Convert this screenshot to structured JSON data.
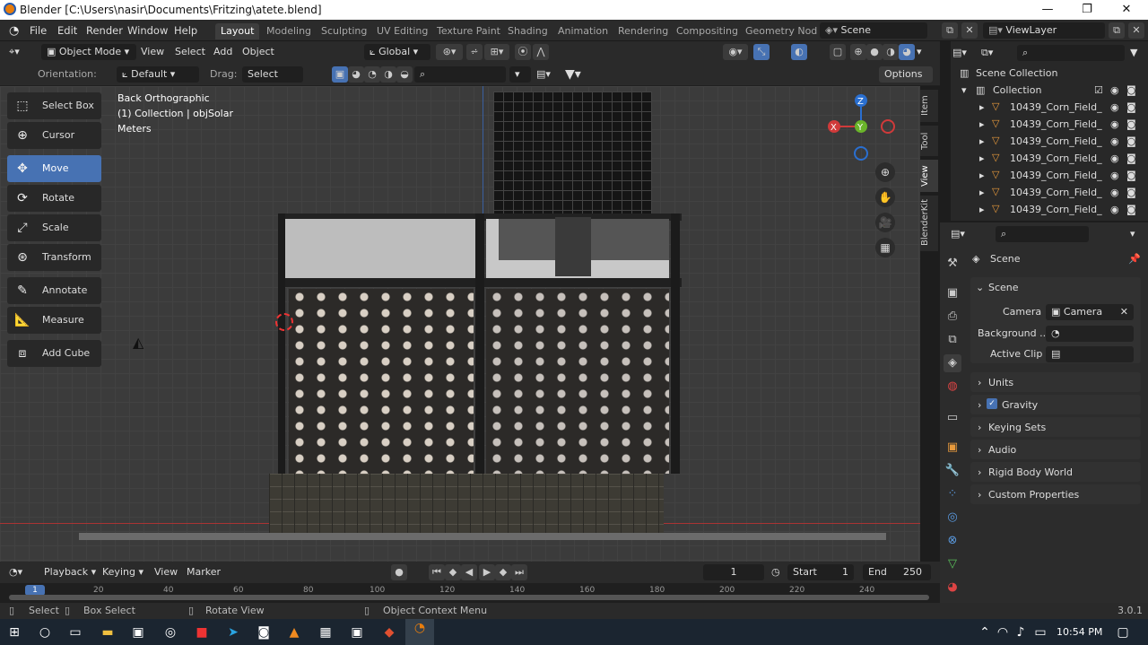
{
  "window": {
    "title": "Blender [C:\\Users\\nasir\\Documents\\Fritzing\\atete.blend]",
    "minimize": "—",
    "maximize": "❐",
    "close": "✕"
  },
  "menu": {
    "items": [
      "File",
      "Edit",
      "Render",
      "Window",
      "Help"
    ]
  },
  "workspaces": [
    "Layout",
    "Modeling",
    "Sculpting",
    "UV Editing",
    "Texture Paint",
    "Shading",
    "Animation",
    "Rendering",
    "Compositing",
    "Geometry Nod"
  ],
  "scene_name": "Scene",
  "view_layer": "ViewLayer",
  "viewport_header": {
    "mode": "Object Mode",
    "menus": [
      "View",
      "Select",
      "Add",
      "Object"
    ],
    "transform": "Global",
    "options": "Options"
  },
  "tool_settings": {
    "orientation_label": "Orientation:",
    "orientation_value": "Default",
    "drag_label": "Drag:",
    "drag_value": "Select Box"
  },
  "toolbar": [
    "Select Box",
    "Cursor",
    "Move",
    "Rotate",
    "Scale",
    "Transform",
    "Annotate",
    "Measure",
    "Add Cube"
  ],
  "viewport_info": {
    "view": "Back Orthographic",
    "collection": "(1) Collection | objSolar",
    "units": "Meters"
  },
  "gizmo": {
    "z": "Z",
    "y": "Y",
    "x": "X"
  },
  "sidebar_tabs": [
    "Item",
    "Tool",
    "View",
    "BlenderKit"
  ],
  "outliner": {
    "root": "Scene Collection",
    "collection": "Collection",
    "items": [
      "10439_Corn_Field_",
      "10439_Corn_Field_",
      "10439_Corn_Field_",
      "10439_Corn_Field_",
      "10439_Corn_Field_",
      "10439_Corn_Field_",
      "10439_Corn_Field_"
    ]
  },
  "properties": {
    "header": "Scene",
    "section": "Scene",
    "camera_label": "Camera",
    "camera_value": "Camera",
    "background_label": "Background ...",
    "active_clip_label": "Active Clip",
    "panels": [
      "Units",
      "Gravity",
      "Keying Sets",
      "Audio",
      "Rigid Body World",
      "Custom Properties"
    ]
  },
  "timeline": {
    "menus": [
      "Playback",
      "Keying",
      "View",
      "Marker"
    ],
    "current_frame": "1",
    "start_label": "Start",
    "start": "1",
    "end_label": "End",
    "end": "250",
    "ruler": [
      "1",
      "20",
      "40",
      "60",
      "80",
      "100",
      "120",
      "140",
      "160",
      "180",
      "200",
      "220",
      "240"
    ]
  },
  "status": {
    "select": "Select",
    "box_select": "Box Select",
    "rotate_view": "Rotate View",
    "context_menu": "Object Context Menu",
    "version": "3.0.1"
  },
  "taskbar": {
    "time": "10:54 PM"
  }
}
